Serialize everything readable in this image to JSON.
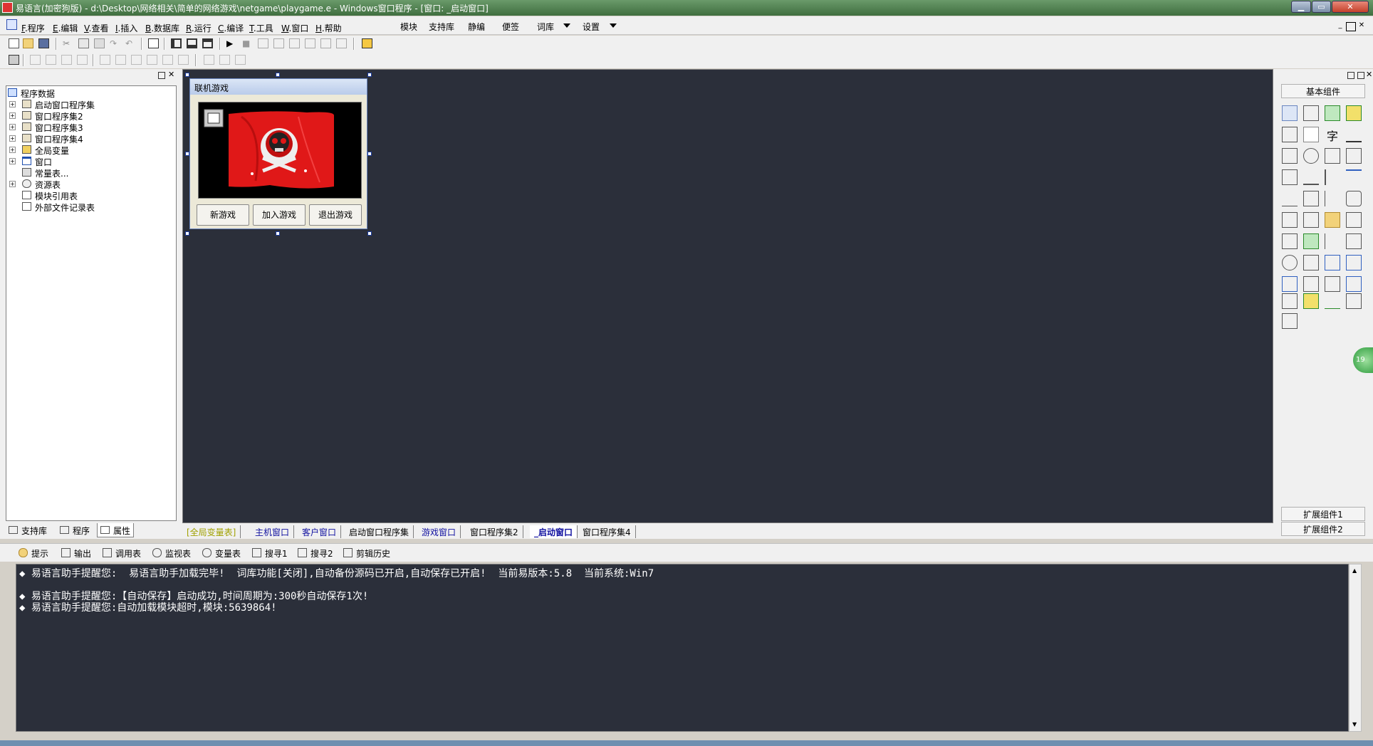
{
  "window": {
    "title": "易语言(加密狗版) - d:\\Desktop\\网络相关\\简单的网络游戏\\netgame\\playgame.e - Windows窗口程序 - [窗口: _启动窗口]",
    "min": "▁",
    "max": "▭",
    "close": "✕"
  },
  "menu": {
    "items": [
      {
        "key": "F",
        "label": ".程序"
      },
      {
        "key": "E",
        "label": ".编辑"
      },
      {
        "key": "V",
        "label": ".查看"
      },
      {
        "key": "I",
        "label": ".插入"
      },
      {
        "key": "B",
        "label": ".数据库"
      },
      {
        "key": "R",
        "label": ".运行"
      },
      {
        "key": "C",
        "label": ".编译"
      },
      {
        "key": "T",
        "label": ".工具"
      },
      {
        "key": "W",
        "label": ".窗口"
      },
      {
        "key": "H",
        "label": ".帮助"
      }
    ],
    "extra": [
      "模块",
      "支持库",
      "静编",
      "便签",
      "词库",
      "设置"
    ]
  },
  "tree": {
    "root": "程序数据",
    "items": [
      "启动窗口程序集",
      "窗口程序集2",
      "窗口程序集3",
      "窗口程序集4",
      "全局变量",
      "窗口",
      "常量表...",
      "资源表",
      "模块引用表",
      "外部文件记录表"
    ]
  },
  "left_tabs": [
    "支持库",
    "程序",
    "属性"
  ],
  "form": {
    "title": "联机游戏",
    "buttons": [
      "新游戏",
      "加入游戏",
      "退出游戏"
    ]
  },
  "editor_tabs": [
    "[全局变量表]",
    "主机窗口",
    "客户窗口",
    "启动窗口程序集",
    "游戏窗口",
    "窗口程序集2",
    "_启动窗口",
    "窗口程序集4"
  ],
  "right_panel": {
    "header": "基本组件",
    "footer1": "扩展组件1",
    "footer2": "扩展组件2"
  },
  "output_tabs": [
    "提示",
    "输出",
    "调用表",
    "监视表",
    "变量表",
    "搜寻1",
    "搜寻2",
    "剪辑历史"
  ],
  "output_lines": [
    "◆ 易语言助手提醒您:  易语言助手加载完毕!  词库功能[关闭],自动备份源码已开启,自动保存已开启!  当前易版本:5.8  当前系统:Win7",
    "",
    "◆ 易语言助手提醒您:【自动保存】启动成功,时间周期为:300秒自动保存1次!",
    "◆ 易语言助手提醒您:自动加载模块超时,模块:5639864!"
  ],
  "badge": "19",
  "colors": {
    "editor_bg": "#2b2f3a",
    "flag_red": "#e01818",
    "title_green": "#4a7c4a"
  }
}
